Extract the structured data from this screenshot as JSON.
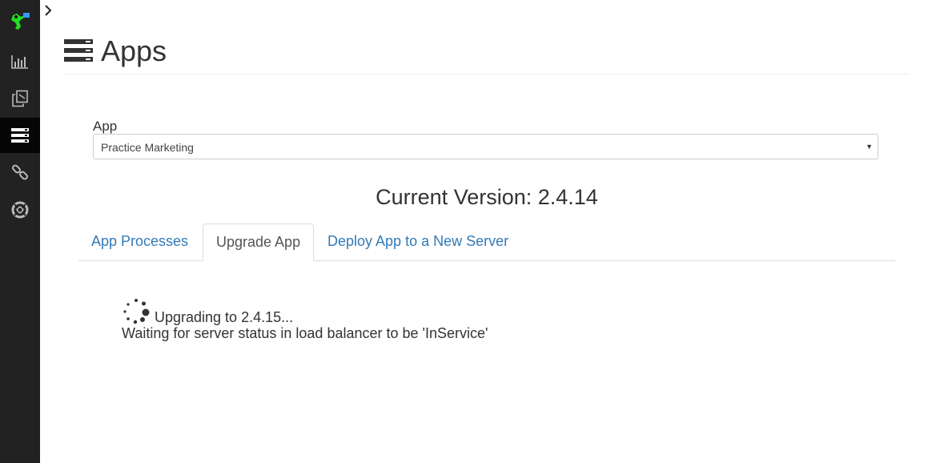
{
  "sidebar": {
    "items": [
      {
        "icon": "logo-icon"
      },
      {
        "icon": "bar-chart-icon"
      },
      {
        "icon": "copy-icon"
      },
      {
        "icon": "server-icon",
        "active": true
      },
      {
        "icon": "link-icon"
      },
      {
        "icon": "life-ring-icon"
      }
    ],
    "active_color": "#050505",
    "background": "#222222"
  },
  "page": {
    "title": "Apps",
    "title_icon": "server-icon"
  },
  "app_select": {
    "label": "App",
    "value": "Practice Marketing"
  },
  "current_version": "Current Version: 2.4.14",
  "tabs": [
    {
      "label": "App Processes",
      "active": false
    },
    {
      "label": "Upgrade App",
      "active": true
    },
    {
      "label": "Deploy App to a New Server",
      "active": false
    }
  ],
  "status": {
    "line1": "Upgrading to 2.4.15...",
    "line2": "Waiting for server status in load balancer to be 'InService'",
    "icon": "spinner-icon"
  },
  "colors": {
    "link": "#337ab7",
    "text": "#333333",
    "logo": "#22dd22"
  }
}
